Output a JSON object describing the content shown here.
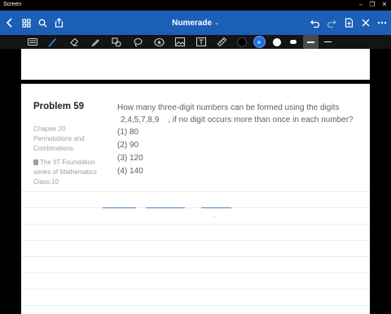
{
  "os": {
    "title": "Screen"
  },
  "app": {
    "title": "Numerade",
    "accent": "#1b5fb6"
  },
  "problem": {
    "title": "Problem 59",
    "chapter": "Chapter 20",
    "chapter_name_1": "Permutations and",
    "chapter_name_2": "Combinations",
    "book_1": "The IIT Foundation",
    "book_2": "series of Mathematics",
    "book_3": "Class:10",
    "question_line1": "How many three-digit numbers can be formed using the digits",
    "question_digits": "2,4,5,7,8,9",
    "question_line2": ", if no digit occurs more than once in each number?",
    "options": [
      "(1) 80",
      "(2) 90",
      "(3) 120",
      "(4) 140"
    ]
  },
  "toolbar_icons": [
    "back-icon",
    "grid-icon",
    "search-icon",
    "share-icon",
    "undo-icon",
    "redo-icon",
    "add-page-icon",
    "close-icon",
    "more-icon"
  ],
  "colors": {
    "black": "#000000",
    "blue": "#1e6fe0",
    "white": "#ffffff"
  }
}
